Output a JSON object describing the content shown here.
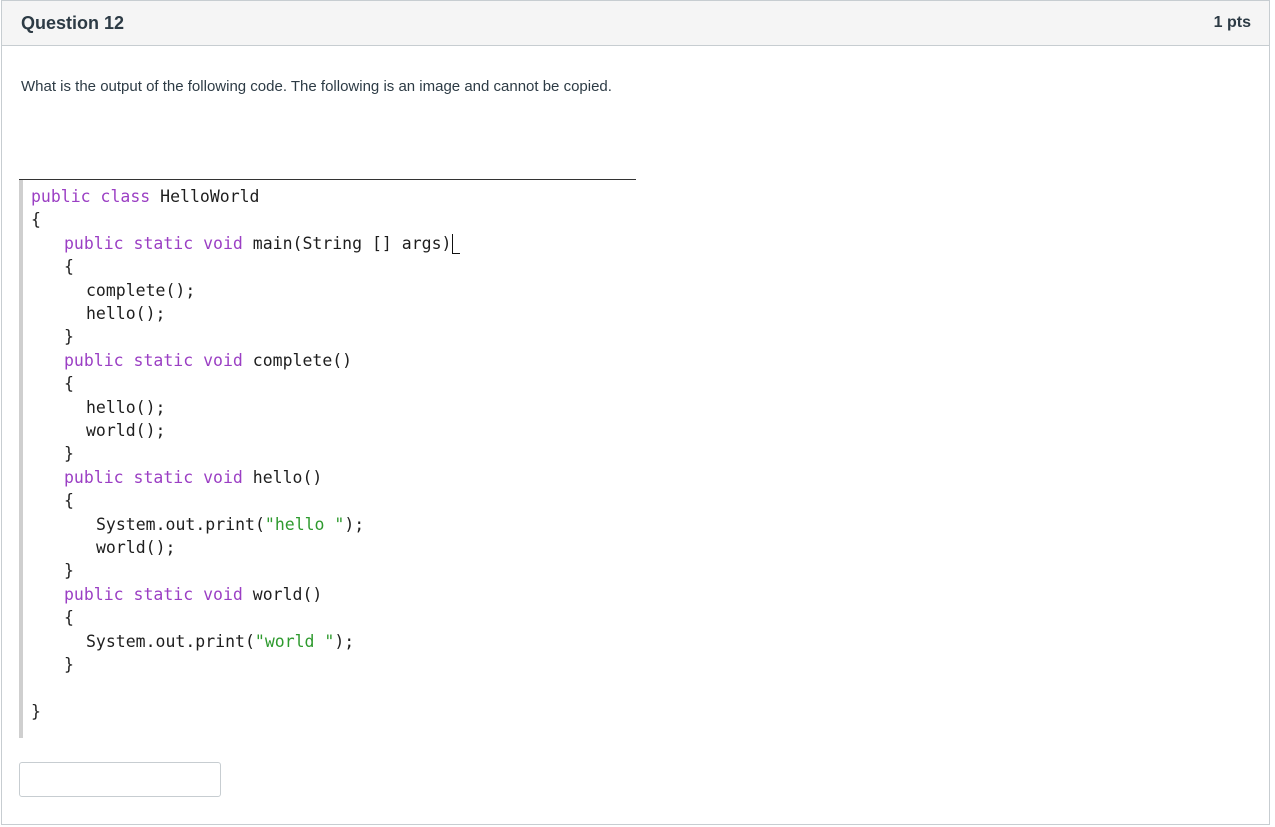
{
  "question": {
    "title": "Question 12",
    "points": "1 pts",
    "prompt": "What is the output of the following code. The following is an image and cannot be copied."
  },
  "code": {
    "colors": {
      "keyword": "#9b3fc4",
      "string": "#2e9a2e",
      "plain": "#1e1e1e"
    },
    "lines": [
      {
        "indent": 0,
        "tokens": [
          {
            "t": "kw",
            "v": "public"
          },
          {
            "t": "p",
            "v": " "
          },
          {
            "t": "kw",
            "v": "class"
          },
          {
            "t": "p",
            "v": " HelloWorld"
          }
        ]
      },
      {
        "indent": 0,
        "tokens": [
          {
            "t": "p",
            "v": "{"
          }
        ]
      },
      {
        "indent": 1,
        "tokens": [
          {
            "t": "kw",
            "v": "public"
          },
          {
            "t": "p",
            "v": " "
          },
          {
            "t": "kw",
            "v": "static"
          },
          {
            "t": "p",
            "v": " "
          },
          {
            "t": "kw",
            "v": "void"
          },
          {
            "t": "p",
            "v": " main(String [] args)"
          }
        ],
        "cursor": true
      },
      {
        "indent": 1,
        "tokens": [
          {
            "t": "p",
            "v": "{"
          }
        ]
      },
      {
        "indent": 2,
        "tokens": [
          {
            "t": "p",
            "v": "complete();"
          }
        ]
      },
      {
        "indent": 2,
        "tokens": [
          {
            "t": "p",
            "v": "hello();"
          }
        ]
      },
      {
        "indent": 1,
        "tokens": [
          {
            "t": "p",
            "v": "}"
          }
        ]
      },
      {
        "indent": 1,
        "tokens": [
          {
            "t": "kw",
            "v": "public"
          },
          {
            "t": "p",
            "v": " "
          },
          {
            "t": "kw",
            "v": "static"
          },
          {
            "t": "p",
            "v": " "
          },
          {
            "t": "kw",
            "v": "void"
          },
          {
            "t": "p",
            "v": " complete()"
          }
        ]
      },
      {
        "indent": 1,
        "tokens": [
          {
            "t": "p",
            "v": "{"
          }
        ]
      },
      {
        "indent": 2,
        "tokens": [
          {
            "t": "p",
            "v": "hello();"
          }
        ]
      },
      {
        "indent": 2,
        "tokens": [
          {
            "t": "p",
            "v": "world();"
          }
        ]
      },
      {
        "indent": 1,
        "tokens": [
          {
            "t": "p",
            "v": "}"
          }
        ]
      },
      {
        "indent": 1,
        "tokens": [
          {
            "t": "kw",
            "v": "public"
          },
          {
            "t": "p",
            "v": " "
          },
          {
            "t": "kw",
            "v": "static"
          },
          {
            "t": "p",
            "v": " "
          },
          {
            "t": "kw",
            "v": "void"
          },
          {
            "t": "p",
            "v": " hello()"
          }
        ]
      },
      {
        "indent": 1,
        "tokens": [
          {
            "t": "p",
            "v": "{"
          }
        ]
      },
      {
        "indent": 3,
        "tokens": [
          {
            "t": "p",
            "v": "System.out.print("
          },
          {
            "t": "str",
            "v": "\"hello \""
          },
          {
            "t": "p",
            "v": ");"
          }
        ]
      },
      {
        "indent": 3,
        "tokens": [
          {
            "t": "p",
            "v": "world();"
          }
        ]
      },
      {
        "indent": 1,
        "tokens": [
          {
            "t": "p",
            "v": "}"
          }
        ]
      },
      {
        "indent": 1,
        "tokens": [
          {
            "t": "kw",
            "v": "public"
          },
          {
            "t": "p",
            "v": " "
          },
          {
            "t": "kw",
            "v": "static"
          },
          {
            "t": "p",
            "v": " "
          },
          {
            "t": "kw",
            "v": "void"
          },
          {
            "t": "p",
            "v": " world()"
          }
        ]
      },
      {
        "indent": 1,
        "tokens": [
          {
            "t": "p",
            "v": "{"
          }
        ]
      },
      {
        "indent": 2,
        "tokens": [
          {
            "t": "p",
            "v": "System.out.print("
          },
          {
            "t": "str",
            "v": "\"world \""
          },
          {
            "t": "p",
            "v": ");"
          }
        ]
      },
      {
        "indent": 1,
        "tokens": [
          {
            "t": "p",
            "v": "}"
          }
        ]
      },
      {
        "indent": 0,
        "tokens": [
          {
            "t": "p",
            "v": ""
          }
        ]
      },
      {
        "indent": 0,
        "tokens": [
          {
            "t": "p",
            "v": "}"
          }
        ]
      }
    ]
  },
  "answer": {
    "value": "",
    "placeholder": ""
  }
}
